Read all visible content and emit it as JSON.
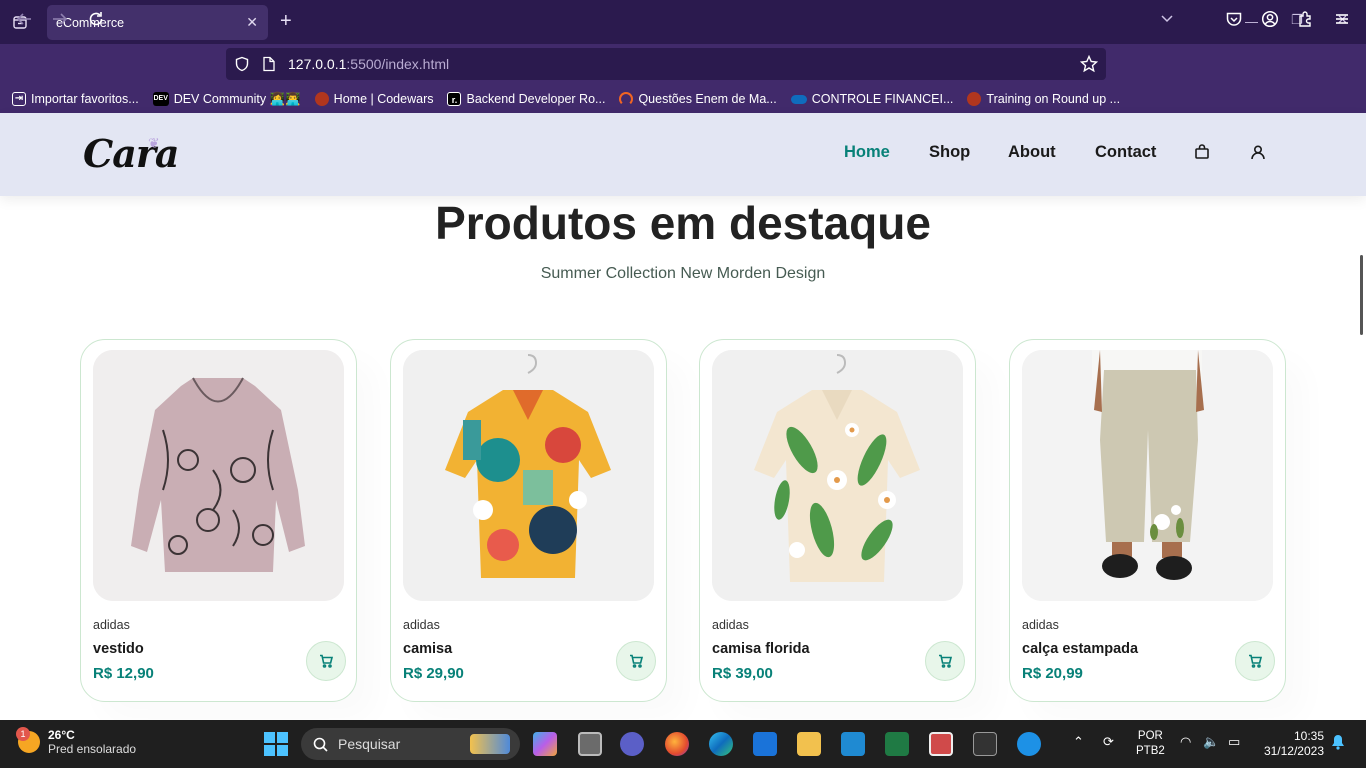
{
  "browser": {
    "tab_title": "eCommerce",
    "url_host": "127.0.0.1",
    "url_rest": ":5500/index.html",
    "bookmarks": [
      {
        "label": "Importar favoritos...",
        "color": "#412a6b"
      },
      {
        "label": "DEV Community 👩‍💻👨‍💻",
        "color": "#000000"
      },
      {
        "label": "Home | Codewars",
        "color": "#b1361e"
      },
      {
        "label": "Backend Developer Ro...",
        "color": "#000000"
      },
      {
        "label": "Questões Enem de Ma...",
        "color": "#f26522"
      },
      {
        "label": "CONTROLE FINANCEI...",
        "color": "#0f6cbd"
      },
      {
        "label": "Training on Round up ...",
        "color": "#b1361e"
      }
    ]
  },
  "site": {
    "logo": "Cara",
    "nav": [
      {
        "label": "Home",
        "active": true
      },
      {
        "label": "Shop",
        "active": false
      },
      {
        "label": "About",
        "active": false
      },
      {
        "label": "Contact",
        "active": false
      }
    ],
    "section_title": "Produtos em destaque",
    "section_subtitle": "Summer Collection New Morden Design",
    "products": [
      {
        "brand": "adidas",
        "name": "vestido",
        "price": "R$ 12,90",
        "image": "lilac-cat-print-blouse"
      },
      {
        "brand": "adidas",
        "name": "camisa",
        "price": "R$ 29,90",
        "image": "colorful-abstract-shirt"
      },
      {
        "brand": "adidas",
        "name": "camisa florida",
        "price": "R$ 39,00",
        "image": "floral-shirt"
      },
      {
        "brand": "adidas",
        "name": "calça estampada",
        "price": "R$ 20,99",
        "image": "printed-linen-pants"
      }
    ],
    "accent_color": "#088178"
  },
  "taskbar": {
    "weather_temp": "26°C",
    "weather_desc": "Pred ensolarado",
    "weather_badge": "1",
    "search_placeholder": "Pesquisar",
    "lang_line1": "POR",
    "lang_line2": "PTB2",
    "time": "10:35",
    "date": "31/12/2023"
  }
}
